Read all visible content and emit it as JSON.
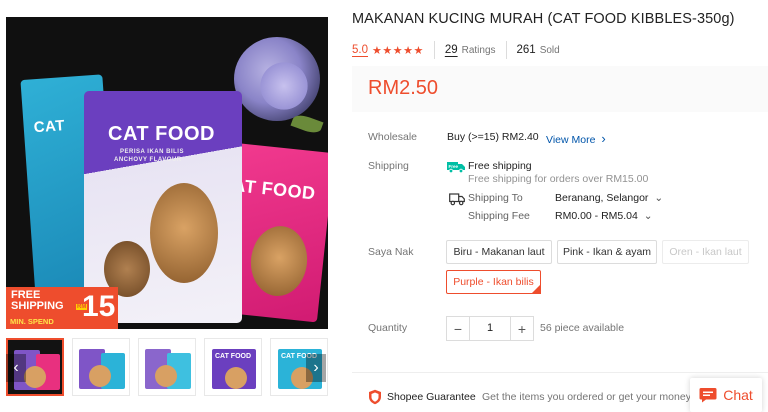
{
  "product": {
    "title": "MAKANAN KUCING MURAH (CAT FOOD KIBBLES-350g)",
    "rating": "5.0",
    "stars": "★★★★★",
    "ratings_count": "29",
    "ratings_label": "Ratings",
    "sold_count": "261",
    "sold_label": "Sold",
    "price": "RM2.50"
  },
  "image": {
    "pack_title_left": "CAT",
    "pack_title_main": "CAT FOOD",
    "pack_subtitle": "PERISA IKAN BILIS",
    "pack_subtitle2": "ANCHOVY FLAVOUR",
    "pack_title_right": "AT FOOD",
    "promo": {
      "line1": "FREE",
      "line2": "SHIPPING",
      "min_spend": "MIN. SPEND",
      "rm": "RM",
      "amount": "15"
    },
    "thumb_labels": [
      "CAT FOOD",
      "CAT FOOD"
    ]
  },
  "wholesale": {
    "label": "Wholesale",
    "value": "Buy (>=15) RM2.40",
    "link": "View More",
    "chevron": "›"
  },
  "shipping": {
    "label": "Shipping",
    "free_label": "Free shipping",
    "free_note": "Free shipping for orders over RM15.00",
    "to_label": "Shipping To",
    "to_value": "Beranang, Selangor",
    "fee_label": "Shipping Fee",
    "fee_value": "RM0.00 - RM5.04",
    "caret": "⌄"
  },
  "variants": {
    "label": "Saya Nak",
    "options": [
      "Biru - Makanan laut",
      "Pink - Ikan & ayam",
      "Oren - Ikan laut",
      "Purple - Ikan bilis"
    ]
  },
  "quantity": {
    "label": "Quantity",
    "minus": "−",
    "value": "1",
    "plus": "+",
    "available": "56 piece available"
  },
  "guarantee": {
    "title": "Shopee Guarantee",
    "text": "Get the items you ordered or get your money back."
  },
  "chat": {
    "label": "Chat"
  },
  "colors": {
    "brand": "#ee4d2d",
    "link": "#0055aa",
    "free_ship": "#00bfa5"
  },
  "icons": {
    "prev": "‹",
    "next": "›"
  }
}
